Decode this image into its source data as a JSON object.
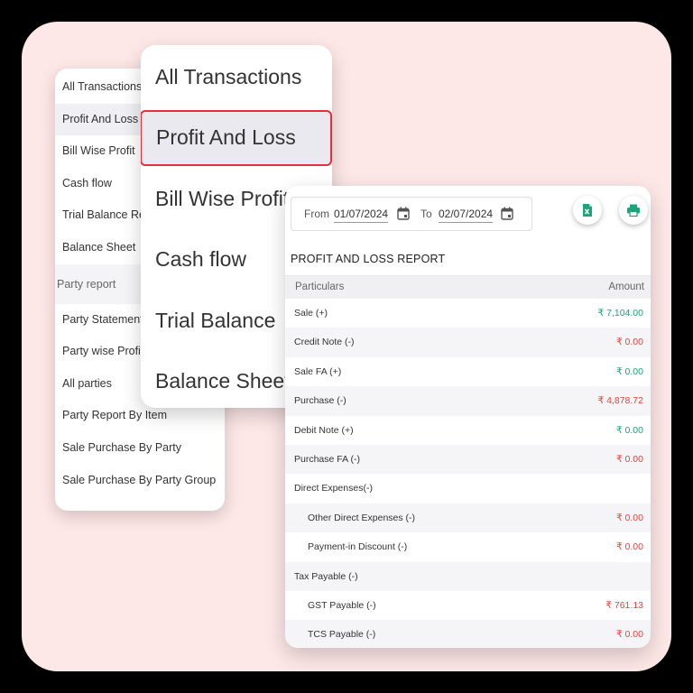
{
  "sidebar": {
    "items": [
      {
        "label": "All Transactions",
        "active": false
      },
      {
        "label": "Profit And Loss",
        "active": true
      },
      {
        "label": "Bill Wise Profit",
        "active": false
      },
      {
        "label": "Cash flow",
        "active": false
      },
      {
        "label": "Trial Balance Report",
        "active": false
      },
      {
        "label": "Balance Sheet",
        "active": false
      }
    ],
    "section_label": "Party report",
    "party_items": [
      {
        "label": "Party Statement"
      },
      {
        "label": "Party wise Profit & Loss"
      },
      {
        "label": "All parties"
      },
      {
        "label": "Party Report By Item"
      },
      {
        "label": "Sale Purchase By Party"
      },
      {
        "label": "Sale Purchase By Party Group"
      }
    ]
  },
  "zoom_menu": {
    "items": [
      {
        "label": "All Transactions",
        "active": false
      },
      {
        "label": "Profit And Loss",
        "active": true
      },
      {
        "label": "Bill Wise Profit",
        "active": false
      },
      {
        "label": "Cash flow",
        "active": false
      },
      {
        "label": "Trial Balance",
        "active": false
      },
      {
        "label": "Balance Sheet",
        "active": false
      }
    ],
    "highlight_color": "#e0323c"
  },
  "report": {
    "from_label": "From",
    "from_date": "01/07/2024",
    "to_label": "To",
    "to_date": "02/07/2024",
    "excel_icon": "excel-export-icon",
    "print_icon": "print-icon",
    "title": "PROFIT AND LOSS REPORT",
    "columns": {
      "particulars": "Particulars",
      "amount": "Amount"
    },
    "rows": [
      {
        "name": "Sale (+)",
        "amount": "₹ 7,104.00",
        "tone": "green",
        "sub": false
      },
      {
        "name": "Credit Note (-)",
        "amount": "₹ 0.00",
        "tone": "red",
        "sub": false
      },
      {
        "name": "Sale FA (+)",
        "amount": "₹ 0.00",
        "tone": "green",
        "sub": false
      },
      {
        "name": "Purchase (-)",
        "amount": "₹ 4,878.72",
        "tone": "red",
        "sub": false
      },
      {
        "name": "Debit Note (+)",
        "amount": "₹ 0.00",
        "tone": "green",
        "sub": false
      },
      {
        "name": "Purchase FA (-)",
        "amount": "₹ 0.00",
        "tone": "red",
        "sub": false
      },
      {
        "name": "Direct Expenses(-)",
        "amount": "",
        "tone": "",
        "sub": false
      },
      {
        "name": "Other Direct Expenses (-)",
        "amount": "₹ 0.00",
        "tone": "red",
        "sub": true
      },
      {
        "name": "Payment-in Discount (-)",
        "amount": "₹ 0.00",
        "tone": "red",
        "sub": true
      },
      {
        "name": "Tax Payable (-)",
        "amount": "",
        "tone": "",
        "sub": false
      },
      {
        "name": "GST Payable (-)",
        "amount": "₹ 761.13",
        "tone": "red",
        "sub": true
      },
      {
        "name": "TCS Payable (-)",
        "amount": "₹ 0.00",
        "tone": "red",
        "sub": true
      }
    ],
    "colors": {
      "positive": "#1aa57a",
      "negative": "#e0443e",
      "accent": "#1aa57a"
    }
  }
}
